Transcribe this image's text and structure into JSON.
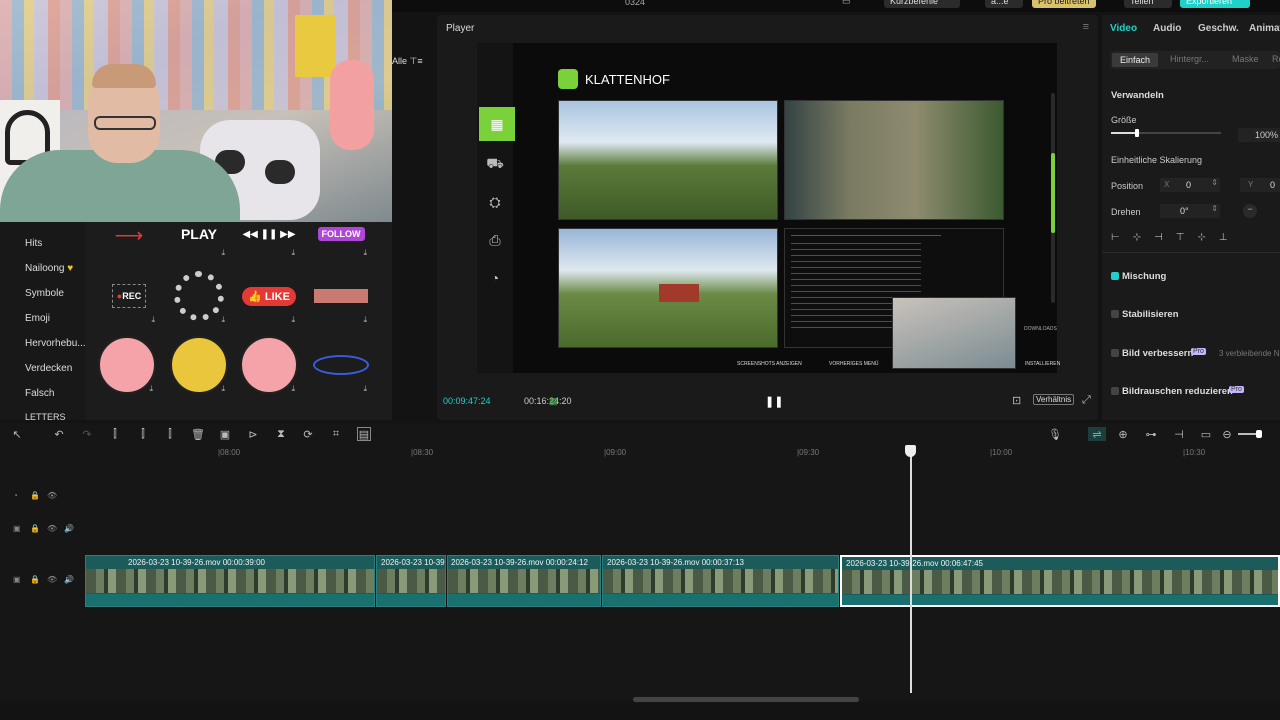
{
  "titlebar": {
    "title": "0324",
    "shortcuts_label": "Kurzbefehle",
    "user_label": "a...e",
    "pro_label": "Pro beitreten",
    "share_label": "Teilen",
    "export_label": "Exportieren"
  },
  "left_panel": {
    "filter_label": "Alle",
    "categories": [
      "Hits",
      "Nailoong",
      "Symbole",
      "Emoji",
      "Hervorhebu...",
      "Verdecken",
      "Falsch",
      "LETTERS"
    ],
    "stickers": {
      "play": "PLAY",
      "follow": "FOLLOW",
      "rec": "REC",
      "like": "LIKE"
    }
  },
  "player": {
    "header": "Player",
    "brand": "KLATTENHOF",
    "current_time": "00:09:47:24",
    "total_time": "00:16:24:20",
    "ratio_label": "Verhältnis",
    "screen_buttons": [
      "SCREENSHOTS ANZEIGEN",
      "VORHERIGES MENÜ",
      "INSTALLIEREN"
    ],
    "downloads_label": "DOWNLOADS"
  },
  "right_panel": {
    "tabs": [
      "Video",
      "Audio",
      "Geschw.",
      "Animat"
    ],
    "subtabs": [
      "Einfach",
      "Hintergr...",
      "Maske",
      "Re"
    ],
    "section_transform": "Verwandeln",
    "size_label": "Größe",
    "size_value": "100%",
    "uniform_scale": "Einheitliche Skalierung",
    "position_label": "Position",
    "pos_x_label": "X",
    "pos_x": "0",
    "pos_y_label": "Y",
    "pos_y": "0",
    "rotate_label": "Drehen",
    "rotate_value": "0°",
    "mix_label": "Mischung",
    "stabilize_label": "Stabilisieren",
    "enhance_label": "Bild verbessern",
    "enhance_note": "3 verbleibende N",
    "denoise_label": "Bildrauschen reduzieren",
    "pro_badge": "Pro"
  },
  "timeline": {
    "ruler": [
      "|08:00",
      "|08:30",
      "|09:00",
      "|09:30",
      "|10:00",
      "|10:30"
    ],
    "clips": [
      {
        "label": "2026-03-23 10-39-26.mov   00:00:39:00"
      },
      {
        "label": "2026-03-23 10-39-"
      },
      {
        "label": "2026-03-23 10-39-26.mov   00:00:24:12"
      },
      {
        "label": "2026-03-23 10-39-26.mov   00:00:37:13"
      },
      {
        "label": "2026-03-23 10-39-26.mov   00:06:47:45"
      }
    ]
  },
  "colors": {
    "accent": "#1fd1c9",
    "clip": "#1d5b5b",
    "bg": "#161616"
  }
}
